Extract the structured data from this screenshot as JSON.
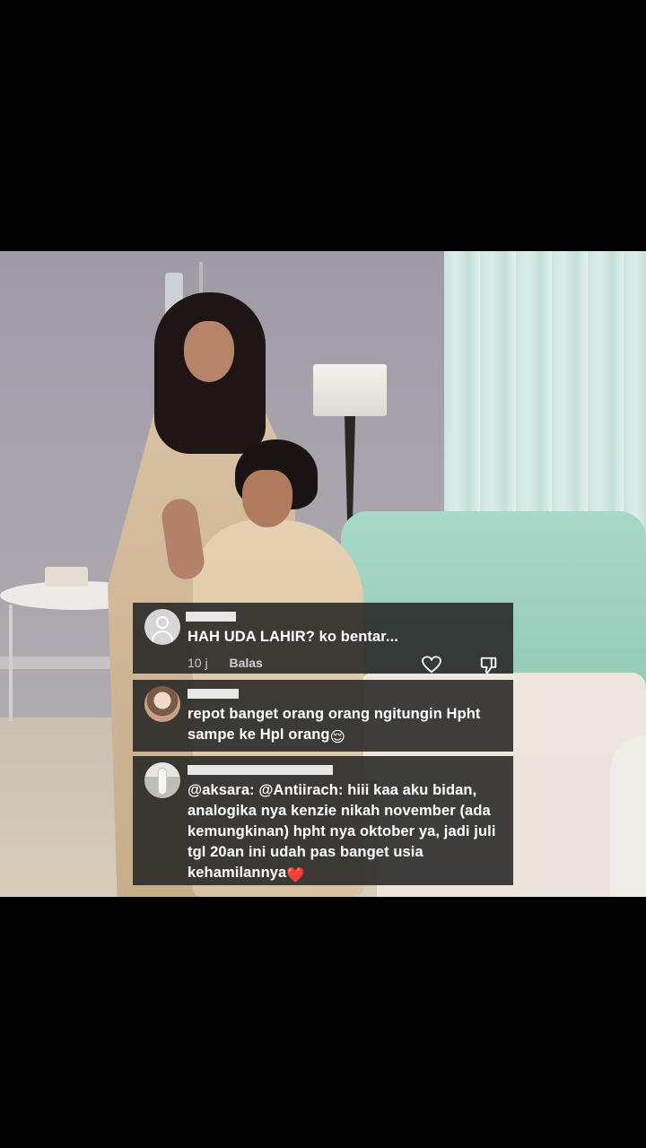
{
  "video": {
    "description_label": ""
  },
  "comments": [
    {
      "text": "HAH UDA LAHIR? ko bentar...",
      "time": "10 j",
      "reply_label": "Balas",
      "avatar": "default-avatar-icon"
    },
    {
      "text_lines": [
        "repot banget orang orang ngitungin Hpht",
        "sampe ke Hpl orang"
      ],
      "emoji": "😌",
      "avatar": "user-photo"
    },
    {
      "text_lines": [
        "@aksara: @Antiirach: hiii kaa aku bidan,",
        "analogika nya kenzie nikah november (ada",
        "kemungkinan) hpht nya oktober ya, jadi juli",
        "tgl 20an ini udah pas banget usia",
        "kehamilannya"
      ],
      "emoji": "❤️",
      "avatar": "user-photo"
    }
  ],
  "icons": {
    "like": "heart-icon",
    "dislike": "thumbs-down-icon"
  },
  "colors": {
    "comment_bg": "#262626",
    "heart": "#ff2d2d"
  }
}
